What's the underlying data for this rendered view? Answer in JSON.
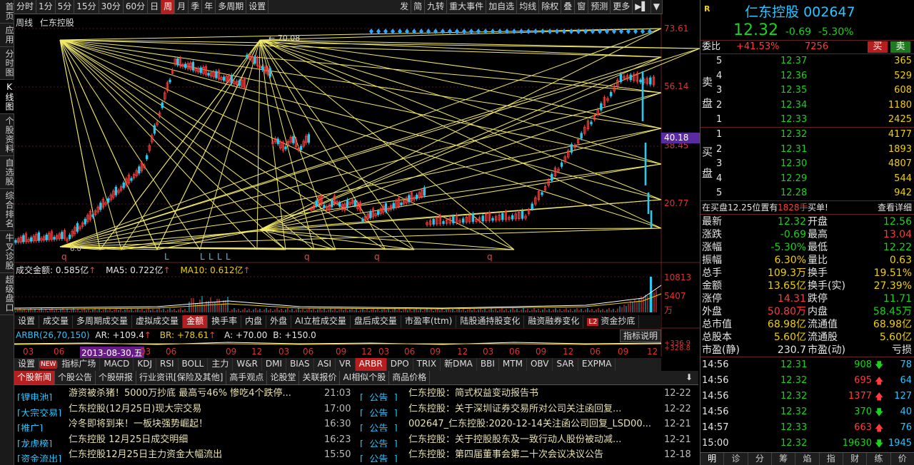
{
  "left_tabs": [
    "首页",
    "应用",
    "分时图",
    "K线图",
    "个股资料",
    "自选股",
    "综合排名",
    "牛叉诊股",
    "超级盘口"
  ],
  "left_tab_active": 3,
  "toolbar": {
    "left": [
      "分时",
      "1分",
      "5分",
      "15分",
      "30分",
      "60分",
      "日",
      "周",
      "月",
      "季",
      "年",
      "多周期",
      "设置"
    ],
    "active": 7,
    "right": [
      "发",
      "简",
      "九转",
      "重大事件",
      "加自选",
      "均线",
      "除权",
      "叠",
      "窗",
      "预测",
      "更多",
      "▶▌",
      "▼"
    ]
  },
  "chart": {
    "period_label": "周线",
    "stock_name": "仁东控股",
    "high_label": "70.08",
    "low_label": "6.0",
    "price_axis": [
      "73.61",
      "56.14",
      "38.45",
      "20.77"
    ],
    "current_price_tag": "40.18",
    "volume_header": {
      "amount_label": "成交金额:",
      "amount_value": "0.585亿",
      "ma5_label": "MA5:",
      "ma5_value": "0.722亿",
      "ma10_label": "MA10:",
      "ma10_value": "0.612亿"
    },
    "volume_axis": [
      "10813",
      "5407",
      "万"
    ],
    "indicator_buttons": [
      "设置",
      "成交量",
      "多周期成交量",
      "虚拟成交量",
      "金额",
      "换手率",
      "内盘",
      "外盘",
      "AI立桩成交量",
      "盘后成交量",
      "市盈率(ttm)",
      "陆股通持股变化",
      "融资融券变化",
      "资金抄底"
    ],
    "indicator_active": 4,
    "l2_badge": "L2",
    "arbr": {
      "label": "ARBR(26,70,150)",
      "ar_label": "AR:",
      "ar_value": "+109.4",
      "br_label": "BR:",
      "br_value": "+78.61",
      "a_label": "A:",
      "a_value": "+70.00",
      "b_label": "B:",
      "b_value": "+150.0",
      "explain": "指标说明",
      "axis_values": [
        "+336.9",
        "+328.8"
      ]
    },
    "time_axis": [
      "03",
      "06",
      "2013-08-30,五",
      "03",
      "06",
      "09",
      "12",
      "03",
      "06",
      "09",
      "12",
      "03",
      "06",
      "09",
      "12",
      "03",
      "06",
      "09",
      "12",
      "06",
      "09",
      "12"
    ],
    "indicator_tabs": [
      "设置",
      "NEW",
      "指标广场",
      "MACD",
      "KDJ",
      "RSI",
      "BOLL",
      "主力",
      "W&R",
      "DMI",
      "BIAS",
      "ASI",
      "VR",
      "ARBR",
      "DPO",
      "TRIX",
      "新DMA",
      "BBI",
      "MTM",
      "OBV",
      "SAR",
      "EXPMA"
    ],
    "indicator_tab_active": 13
  },
  "quote": {
    "logo": "R",
    "name": "仁东控股",
    "code": "002647",
    "price": "12.32",
    "change": "-0.69",
    "change_pct": "-5.30%",
    "weibi_label": "委比",
    "weibi_value": "+41.53%",
    "weibi_diff": "7256",
    "buy_btn": "买",
    "sell_btn": "卖",
    "sell_side_label": [
      "卖",
      "盘"
    ],
    "buy_side_label": [
      "买",
      "盘"
    ],
    "asks": [
      {
        "level": "5",
        "price": "12.37",
        "vol": "365"
      },
      {
        "level": "4",
        "price": "12.36",
        "vol": "529"
      },
      {
        "level": "3",
        "price": "12.35",
        "vol": "608"
      },
      {
        "level": "2",
        "price": "12.34",
        "vol": "1180"
      },
      {
        "level": "1",
        "price": "12.33",
        "vol": "2425"
      }
    ],
    "bids": [
      {
        "level": "1",
        "price": "12.32",
        "vol": "4177"
      },
      {
        "level": "2",
        "price": "12.31",
        "vol": "1893"
      },
      {
        "level": "3",
        "price": "12.30",
        "vol": "4807"
      },
      {
        "level": "4",
        "price": "12.29",
        "vol": "544"
      },
      {
        "level": "5",
        "price": "12.28",
        "vol": "942"
      }
    ],
    "alert_prefix": "在买盘12.25位置有",
    "alert_value": "1828手",
    "alert_suffix": "买单!",
    "alert_link": "查看详细",
    "stats": [
      {
        "l1": "最新",
        "v1": "12.32",
        "c1": "green",
        "l2": "开盘",
        "v2": "12.56",
        "c2": "green"
      },
      {
        "l1": "涨跌",
        "v1": "-0.69",
        "c1": "green",
        "l2": "最高",
        "v2": "13.04",
        "c2": "red"
      },
      {
        "l1": "涨幅",
        "v1": "-5.30%",
        "c1": "green",
        "l2": "最低",
        "v2": "12.22",
        "c2": "green"
      },
      {
        "l1": "振幅",
        "v1": "6.30%",
        "c1": "yellow",
        "l2": "量比",
        "v2": "0.63",
        "c2": "yellow"
      },
      {
        "l1": "总手",
        "v1": "109.3万",
        "c1": "yellow",
        "l2": "换手",
        "v2": "19.51%",
        "c2": "yellow"
      },
      {
        "l1": "金额",
        "v1": "13.65亿",
        "c1": "yellow",
        "l2": "换手(实)",
        "v2": "27.39%",
        "c2": "yellow"
      },
      {
        "l1": "涨停",
        "v1": "14.31",
        "c1": "red",
        "l2": "跌停",
        "v2": "11.71",
        "c2": "green"
      },
      {
        "l1": "外盘",
        "v1": "50.80万",
        "c1": "red",
        "l2": "内盘",
        "v2": "58.45万",
        "c2": "green"
      },
      {
        "l1": "总市值",
        "v1": "68.98亿",
        "c1": "yellow",
        "l2": "流通值",
        "v2": "68.98亿",
        "c2": "yellow"
      },
      {
        "l1": "总股本",
        "v1": "5.60亿",
        "c1": "yellow",
        "l2": "流通股",
        "v2": "5.60亿",
        "c2": "yellow"
      },
      {
        "l1": "市盈(静)",
        "v1": "230.7",
        "c1": "white",
        "l2": "市盈(动)",
        "v2": "亏损",
        "c2": "white"
      }
    ],
    "ticks": [
      {
        "time": "14:56",
        "price": "12.31",
        "pc": "green",
        "vol": "908",
        "vc": "green",
        "dir": "down",
        "n": "78"
      },
      {
        "time": "14:56",
        "price": "12.32",
        "pc": "green",
        "vol": "695",
        "vc": "red",
        "dir": "up",
        "n": "64"
      },
      {
        "time": "14:56",
        "price": "12.32",
        "pc": "green",
        "vol": "1377",
        "vc": "red",
        "dir": "up",
        "n": "127"
      },
      {
        "time": "14:56",
        "price": "12.32",
        "pc": "green",
        "vol": "370",
        "vc": "green",
        "dir": "down",
        "n": "40"
      },
      {
        "time": "14:57",
        "price": "12.33",
        "pc": "green",
        "vol": "663",
        "vc": "red",
        "dir": "up",
        "n": "76"
      },
      {
        "time": "15:00",
        "price": "12.32",
        "pc": "green",
        "vol": "19630",
        "vc": "green",
        "dir": "down",
        "n": "1945"
      }
    ],
    "bottom_tabs": [
      "明",
      "诊",
      "分",
      "筹",
      "焰",
      "指",
      "财",
      "练",
      "价"
    ]
  },
  "news": {
    "tabs": [
      "个股新闻",
      "个股公告",
      "个股研报",
      "行业资讯[保险及其他]",
      "高手观点",
      "论股堂",
      "关联报价",
      "AI相似个股",
      "商品价格"
    ],
    "active": 0,
    "left": [
      {
        "tag": "锂电池",
        "title": "游资被杀猪！5000万抄底 最高亏46% 惨吃4个跌停...",
        "time": "21:03"
      },
      {
        "tag": "大宗交易",
        "title": "仁东控股(12月25日)现大宗交易",
        "time": "17:00"
      },
      {
        "tag": "推广",
        "title": "冷冬即将到来！一板块强势崛起！",
        "time": "16:30"
      },
      {
        "tag": "龙虎榜",
        "title": "仁东控股 12月25日成交明细",
        "time": "16:23"
      },
      {
        "tag": "资金流出",
        "title": "仁东控股12月25日主力资金大幅流出",
        "time": "15:50"
      }
    ],
    "right": [
      {
        "tag": "公告",
        "title": "仁东控股：简式权益变动报告书",
        "date": "12-22"
      },
      {
        "tag": "公告",
        "title": "仁东控股：关于深圳证券交易所对公司关注函回复...",
        "date": "12-22"
      },
      {
        "tag": "公告",
        "title": "002647_仁东控股:2020-12-14关注函公司回复_LSD00...",
        "date": "12-21"
      },
      {
        "tag": "公告",
        "title": "仁东控股：关于控股股东及一致行动人股份被动减...",
        "date": "12-21"
      },
      {
        "tag": "公告",
        "title": "仁东控股：第四届董事会第二十次会议决议公告",
        "date": "12-18"
      }
    ]
  },
  "colors": {
    "up": "#ff3b3b",
    "down": "#19d419",
    "accent": "#b51f1f",
    "fan_lines": "#f2e86a",
    "diamond": "#2ea8ff"
  }
}
